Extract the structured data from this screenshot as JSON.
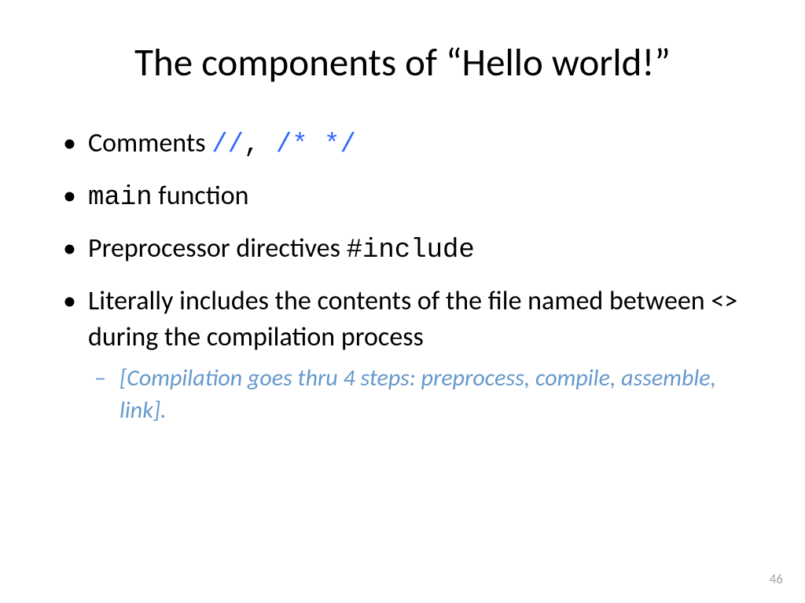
{
  "title": "The components of “Hello world!”",
  "bullets": {
    "b1_label": "Comments   ",
    "b1_code1": "//",
    "b1_sep": ", ",
    "b1_code2": "/*   */",
    "b2_code": "main",
    "b2_rest": " function",
    "b3_label": "Preprocessor directives  ",
    "b3_code": "#include",
    "b4": "Literally includes the contents of the file named between <> during the compilation process",
    "sub1": "[Compilation goes thru 4 steps: preprocess, compile, assemble, link]."
  },
  "slide_number": "46"
}
